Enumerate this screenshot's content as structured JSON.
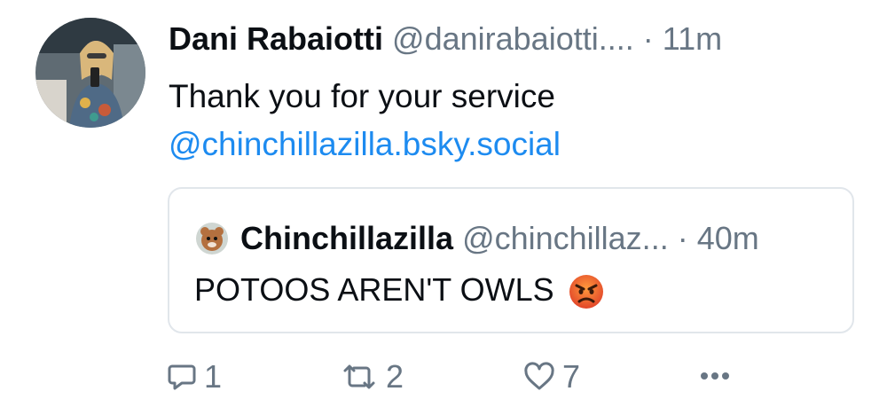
{
  "post": {
    "author_name": "Dani Rabaiotti",
    "author_handle": "@danirabaiotti....",
    "time": "· 11m",
    "text_line1": "Thank you for your service",
    "mention": "@chinchillazilla.bsky.social"
  },
  "quote": {
    "author_name": "Chinchillazilla",
    "author_handle": "@chinchillaz...",
    "time": "· 40m",
    "text": "POTOOS AREN'T OWLS",
    "emoji": "angry-face-icon"
  },
  "actions": {
    "reply_count": "1",
    "repost_count": "2",
    "like_count": "7"
  },
  "colors": {
    "link": "#1d8bf0",
    "muted": "#687684",
    "border": "#e1e6eb"
  }
}
